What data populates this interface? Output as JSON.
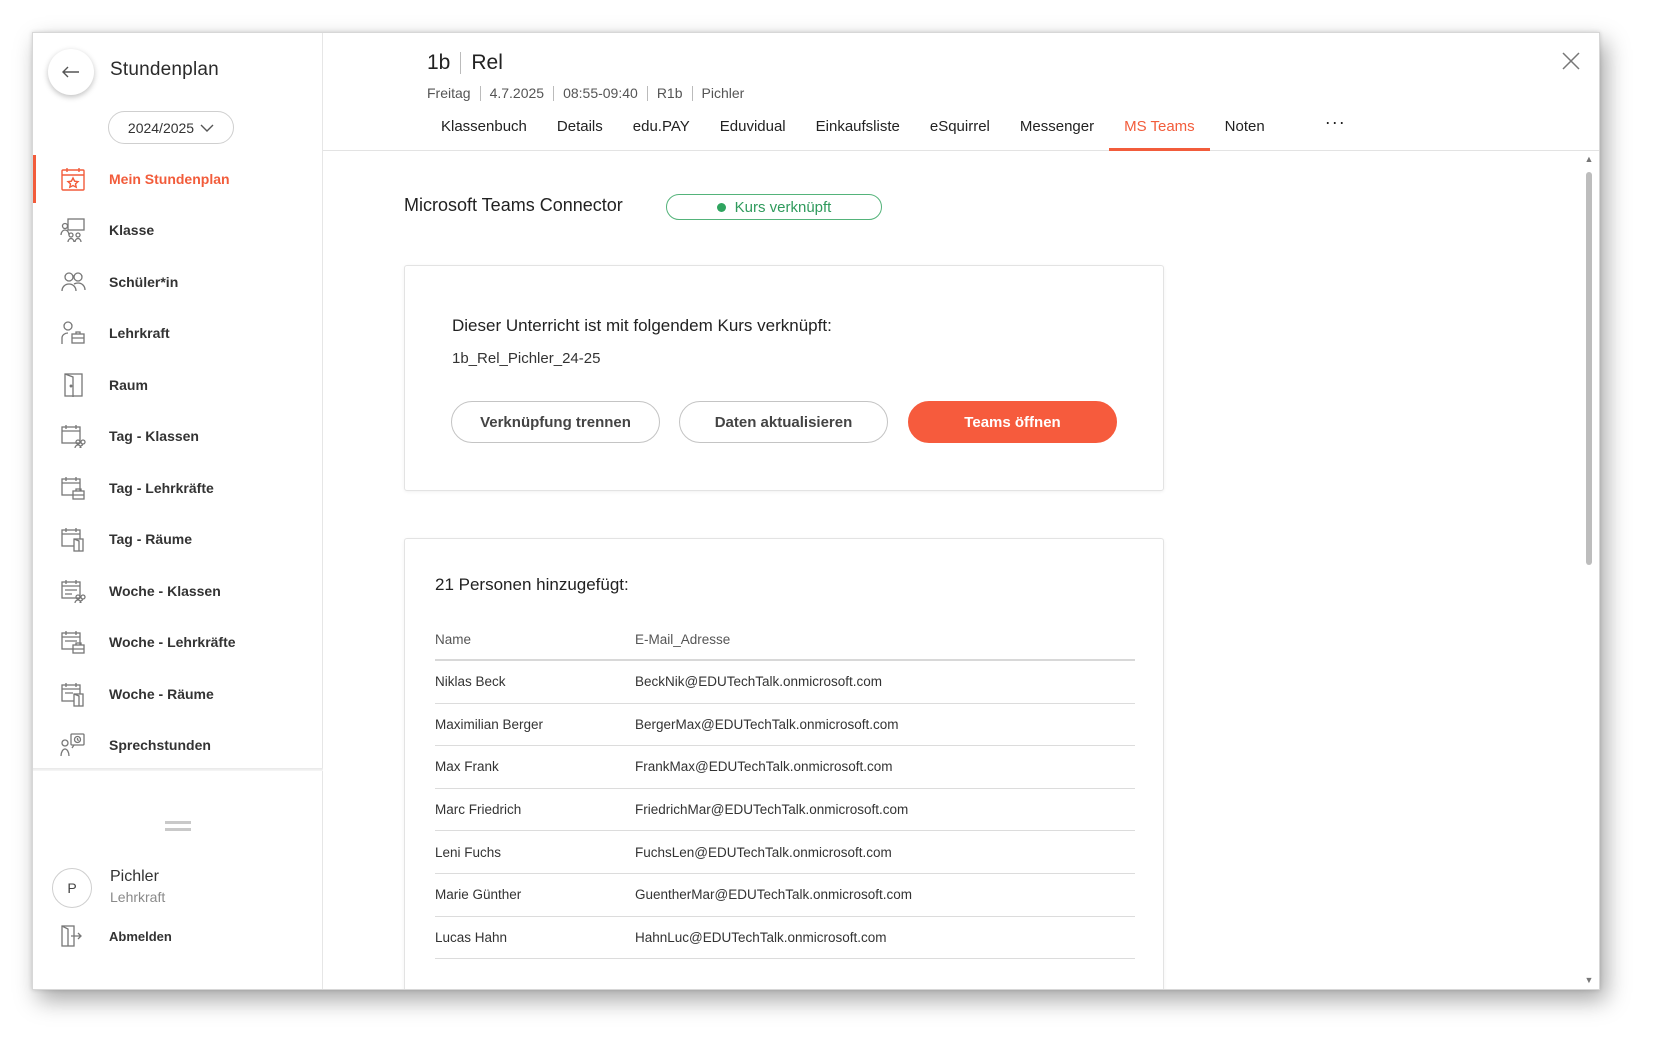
{
  "sidebar": {
    "title": "Stundenplan",
    "year": "2024/2025",
    "items": [
      {
        "label": "Mein Stundenplan"
      },
      {
        "label": "Klasse"
      },
      {
        "label": "Schüler*in"
      },
      {
        "label": "Lehrkraft"
      },
      {
        "label": "Raum"
      },
      {
        "label": "Tag - Klassen"
      },
      {
        "label": "Tag - Lehrkräfte"
      },
      {
        "label": "Tag - Räume"
      },
      {
        "label": "Woche - Klassen"
      },
      {
        "label": "Woche - Lehrkräfte"
      },
      {
        "label": "Woche - Räume"
      },
      {
        "label": "Sprechstunden"
      }
    ],
    "user": {
      "initial": "P",
      "name": "Pichler",
      "role": "Lehrkraft"
    },
    "logout_label": "Abmelden"
  },
  "header": {
    "class": "1b",
    "subject": "Rel",
    "day": "Freitag",
    "date": "4.7.2025",
    "time": "08:55-09:40",
    "room": "R1b",
    "teacher": "Pichler",
    "tabs": [
      {
        "label": "Klassenbuch"
      },
      {
        "label": "Details"
      },
      {
        "label": "edu.PAY"
      },
      {
        "label": "Eduvidual"
      },
      {
        "label": "Einkaufsliste"
      },
      {
        "label": "eSquirrel"
      },
      {
        "label": "Messenger"
      },
      {
        "label": "MS Teams"
      },
      {
        "label": "Noten"
      }
    ],
    "more_label": "···"
  },
  "connector": {
    "title": "Microsoft Teams Connector",
    "status": "Kurs verknüpft",
    "link_card_title": "Dieser Unterricht ist mit folgendem Kurs verknüpft:",
    "course_name": "1b_Rel_Pichler_24-25",
    "buttons": {
      "unlink": "Verknüpfung trennen",
      "refresh": "Daten aktualisieren",
      "open": "Teams öffnen"
    }
  },
  "people": {
    "title": "21 Personen hinzugefügt:",
    "columns": {
      "name": "Name",
      "email": "E-Mail_Adresse"
    },
    "rows": [
      {
        "name": "Niklas Beck",
        "email": "BeckNik@EDUTechTalk.onmicrosoft.com"
      },
      {
        "name": "Maximilian Berger",
        "email": "BergerMax@EDUTechTalk.onmicrosoft.com"
      },
      {
        "name": "Max Frank",
        "email": "FrankMax@EDUTechTalk.onmicrosoft.com"
      },
      {
        "name": "Marc Friedrich",
        "email": "FriedrichMar@EDUTechTalk.onmicrosoft.com"
      },
      {
        "name": "Leni Fuchs",
        "email": "FuchsLen@EDUTechTalk.onmicrosoft.com"
      },
      {
        "name": "Marie Günther",
        "email": "GuentherMar@EDUTechTalk.onmicrosoft.com"
      },
      {
        "name": "Lucas Hahn",
        "email": "HahnLuc@EDUTechTalk.onmicrosoft.com"
      }
    ]
  },
  "colors": {
    "accent": "#f25c3b",
    "success": "#2fa45f"
  }
}
